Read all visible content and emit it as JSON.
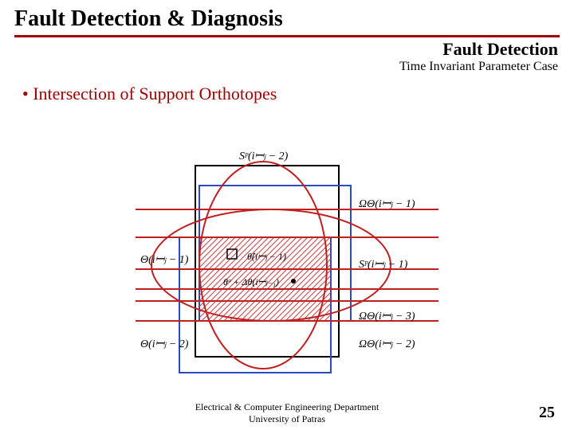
{
  "header": {
    "title": "Fault Detection & Diagnosis",
    "section": "Fault Detection",
    "section_sub": "Time Invariant Parameter Case"
  },
  "content": {
    "bullet1": "Intersection of Support Orthotopes"
  },
  "figure": {
    "labels": {
      "top": "Sᵖ(i𝄩ⱼ − 2)",
      "rightTop": "ΩΘ(i𝄩ⱼ − 1)",
      "rightUpper": "Sᵖ(i𝄩ⱼ − 1)",
      "rightMid": "ΩΘ(i𝄩ⱼ − 3)",
      "rightLow": "ΩΘ(i𝄩ⱼ − 2)",
      "leftUpper": "Θ(i𝄩ⱼ − 1)",
      "leftLower": "Θ(i𝄩ⱼ − 2)",
      "centerA": "θ̂(i𝄩ⱼ − 1)",
      "centerB": "θᵒ + Δθ(i𝄩ⱼ₋₁)"
    }
  },
  "footer": {
    "line1": "Electrical & Computer Engineering Department",
    "line2": "University of Patras"
  },
  "page_number": "25"
}
